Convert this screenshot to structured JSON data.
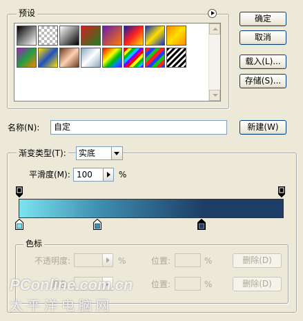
{
  "presets": {
    "title": "预设",
    "swatches": [
      "linear-gradient(135deg,#000 0%,#fff 100%)",
      "repeating-conic-gradient(#bbb 0% 25%, #fff 0% 50%) 0 0/8px 8px",
      "linear-gradient(135deg,#fff 0%,#000 100%)",
      "linear-gradient(135deg,#d02020 0%,#208020 100%)",
      "linear-gradient(135deg,#6a1bb0 0%,#ff7a00 100%)",
      "linear-gradient(135deg,#1a1aa0 0%,#ff2020 50%,#ffe000 100%)",
      "linear-gradient(135deg,#1030c0 0%,#ffe000 50%,#1030c0 100%)",
      "linear-gradient(135deg,#ff8a00 0%,#ffe000 50%,#ff8a00 100%)",
      "linear-gradient(135deg,#a020c0 0%,#20a040 50%,#ff8000 100%)",
      "linear-gradient(135deg,#ffe000 0%,#2050c0 50%,#ffe000 100%)",
      "linear-gradient(135deg,#6b3a20 0%,#ffd2b0 50%,#6b3a20 100%)",
      "linear-gradient(135deg,#8aa8c0 0%,#ffffff 50%,#8aa8c0 100%)",
      "linear-gradient(135deg,#ff0000,#ff8000,#ffff00,#00c000,#0080ff,#8000ff)",
      "repeating-linear-gradient(135deg,#ff0000 0 4px,#ffff00 4px 8px,#00c000 8px 12px,#00c0ff 12px 16px,#8000ff 16px 20px)",
      "repeating-linear-gradient(135deg,#ff2020 0 5px,#2040ff 5px 10px,#20c020 10px 15px)",
      "repeating-linear-gradient(135deg,#000 0 3px,#fff 3px 6px)"
    ]
  },
  "buttons": {
    "ok": "确定",
    "cancel": "取消",
    "load": "载入(L)...",
    "save": "存储(S)...",
    "new": "新建(W)",
    "delete_opacity": "删除(D)",
    "delete_color": "删除(D)"
  },
  "name": {
    "label": "名称(N):",
    "value": "自定"
  },
  "gradient": {
    "type_label": "渐变类型(T):",
    "type_value": "实底",
    "smooth_label": "平滑度(M):",
    "smooth_value": "100",
    "smooth_unit": "%",
    "start_color": "#7be3f0",
    "mid_color": "#3f8fb0",
    "end_color": "#1d3d66"
  },
  "stops": {
    "title": "色标",
    "opacity_label": "不透明度:",
    "opacity_unit": "%",
    "position_label_1": "位置:",
    "position_unit_1": "%",
    "color_label": "颜色:",
    "position_label_2": "位置:",
    "position_unit_2": "%"
  },
  "watermark": {
    "brand": "PConline.com.cn",
    "sub": "太平洋电脑网"
  }
}
